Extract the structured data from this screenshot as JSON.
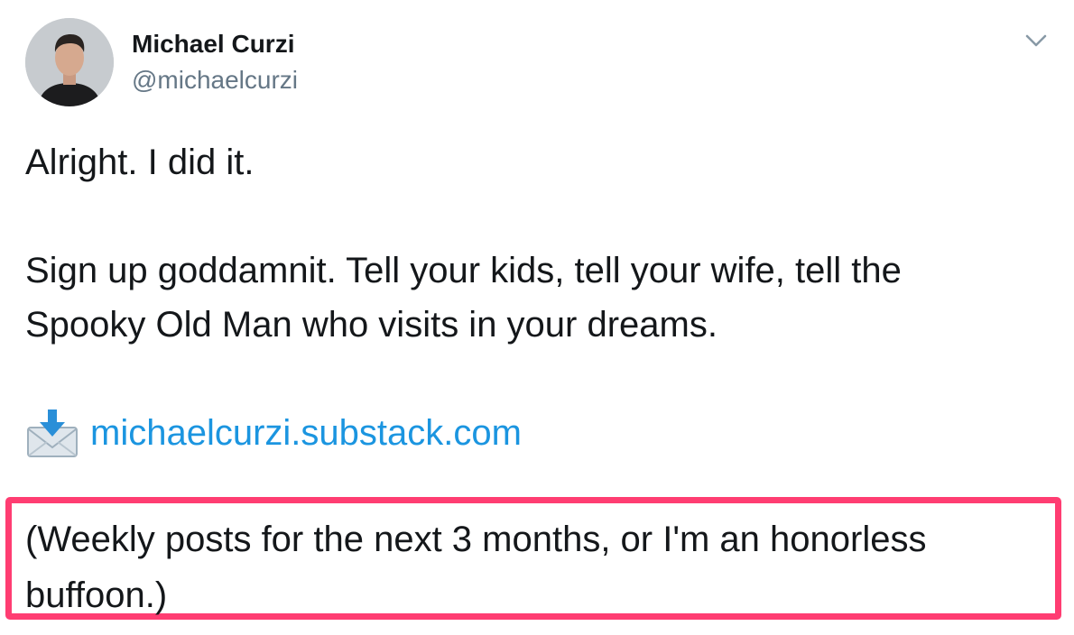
{
  "author": {
    "name": "Michael Curzi",
    "handle": "@michaelcurzi"
  },
  "tweet": {
    "lines": [
      "Alright. I did it.",
      "Sign up goddamnit. Tell your kids, tell your wife, tell the",
      "Spooky Old Man who visits in your dreams.",
      "(Weekly posts for the next 3 months, or I'm an honorless",
      "buffoon.)"
    ],
    "link_text": "michaelcurzi.substack.com"
  },
  "icons": {
    "menu": "chevron-down-icon",
    "link_emoji": "envelope-with-arrow-icon"
  },
  "colors": {
    "link": "#1b95e0",
    "handle": "#657786",
    "highlight_border": "#ff3d72"
  }
}
